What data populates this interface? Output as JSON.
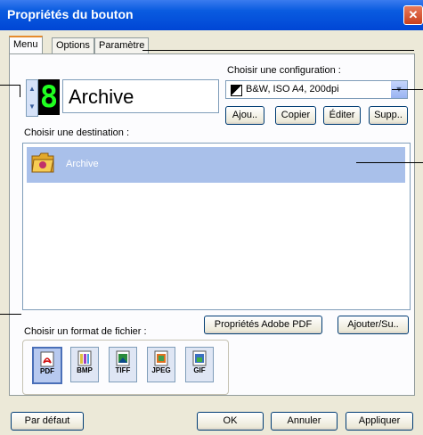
{
  "window": {
    "title": "Propriétés du bouton",
    "close_label": "✕"
  },
  "tabs": [
    {
      "label": "Menu"
    },
    {
      "label": "Options"
    },
    {
      "label": "Paramètre"
    }
  ],
  "button_number": {
    "digit": "8",
    "up": "▲",
    "down": "▼"
  },
  "button_name": "Archive",
  "configuration": {
    "label": "Choisir une configuration :",
    "value": "B&W, ISO A4, 200dpi",
    "dropdown_arrow": "▼",
    "buttons": {
      "add": "Ajou..",
      "copy": "Copier",
      "edit": "Éditer",
      "delete": "Supp.."
    }
  },
  "destination": {
    "label": "Choisir une destination :",
    "items": [
      {
        "name": "Archive",
        "icon": "folder-icon"
      }
    ]
  },
  "file_format": {
    "label": "Choisir un format de fichier :",
    "formats": [
      {
        "name": "PDF",
        "icon": "pdf-icon",
        "selected": true
      },
      {
        "name": "BMP",
        "icon": "bmp-icon",
        "selected": false
      },
      {
        "name": "TIFF",
        "icon": "tiff-icon",
        "selected": false
      },
      {
        "name": "JPEG",
        "icon": "jpeg-icon",
        "selected": false
      },
      {
        "name": "GIF",
        "icon": "gif-icon",
        "selected": false
      }
    ],
    "adobe_pdf_button": "Propriétés Adobe PDF",
    "add_remove_button": "Ajouter/Su.."
  },
  "footer": {
    "default": "Par défaut",
    "ok": "OK",
    "cancel": "Annuler",
    "apply": "Appliquer"
  },
  "colors": {
    "titlebar": "#0a5ce0",
    "selection": "#a9c0ea",
    "window_bg": "#ece9d8"
  }
}
